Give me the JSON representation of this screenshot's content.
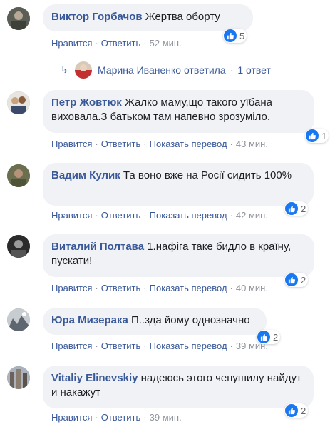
{
  "comments": [
    {
      "author": "Виктор Горбачов",
      "text": "Жертва оборту",
      "likes": "5",
      "actions": {
        "like": "Нравится",
        "reply": "Ответить",
        "translate": "",
        "time": "52 мин."
      }
    },
    {
      "author": "Петр Жовтюк",
      "text": "Жалко маму,що такого уїбана виховала.З батьком там напевно зрозуміло.",
      "likes": "1",
      "actions": {
        "like": "Нравится",
        "reply": "Ответить",
        "translate": "Показать перевод",
        "time": "43 мин."
      }
    },
    {
      "author": "Вадим Кулик",
      "text": "Та воно вже на Росії сидить 100%",
      "likes": "2",
      "actions": {
        "like": "Нравится",
        "reply": "Ответить",
        "translate": "Показать перевод",
        "time": "42 мин."
      }
    },
    {
      "author": "Виталий Полтава",
      "text": "1.нафіга таке бидло в країну, пускати!",
      "likes": "2",
      "actions": {
        "like": "Нравится",
        "reply": "Ответить",
        "translate": "Показать перевод",
        "time": "40 мин."
      }
    },
    {
      "author": "Юра Мизерака",
      "text": "П..зда йому однозначно",
      "likes": "2",
      "actions": {
        "like": "Нравится",
        "reply": "Ответить",
        "translate": "Показать перевод",
        "time": "39 мин."
      }
    },
    {
      "author": "Vitaliy Elinevskiy",
      "text": "надеюсь этого чепушилу найдут и накажут",
      "likes": "2",
      "actions": {
        "like": "Нравится",
        "reply": "Ответить",
        "translate": "",
        "time": "39 мин."
      }
    }
  ],
  "reply_summary": {
    "text": "Марина Иваненко ответила",
    "count": "1 ответ"
  },
  "colors": {
    "link": "#385898",
    "bubble": "#f0f2f5",
    "like": "#1877f2",
    "meta": "#90949c"
  },
  "icons": {
    "like": "thumbs-up-icon",
    "reply_arrow": "reply-arrow-icon"
  }
}
